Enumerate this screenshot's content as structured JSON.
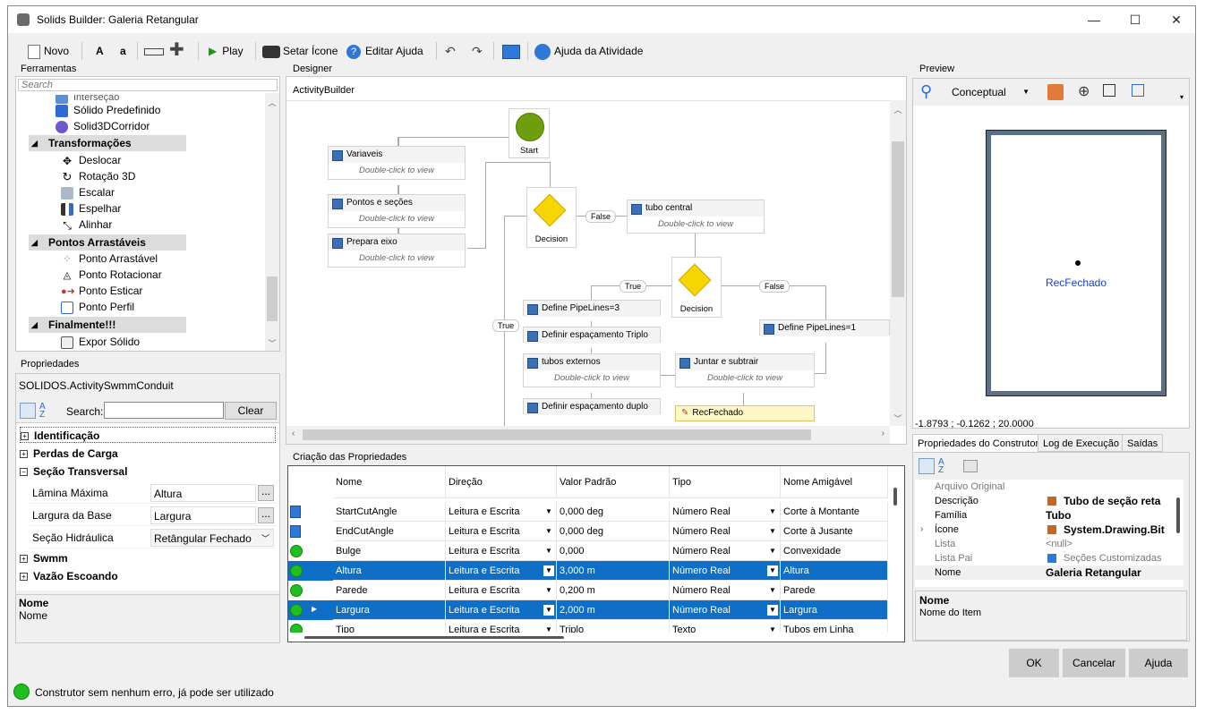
{
  "window": {
    "title": "Solids Builder: Galeria Retangular",
    "minimize": "—",
    "maximize": "☐",
    "close": "✕"
  },
  "toolbar": {
    "novo": "Novo",
    "bold_a": "A",
    "small_a": "a",
    "play": "Play",
    "setar_icone": "Setar Ícone",
    "editar_ajuda": "Editar Ajuda",
    "ajuda_atividade": "Ajuda da Atividade"
  },
  "ferramentas": {
    "title": "Ferramentas",
    "search_placeholder": "Search",
    "partial_item": "Interseção",
    "items_top": [
      "Sólido Predefinido",
      "Solid3DCorridor"
    ],
    "groups": [
      {
        "name": "Transformações",
        "items": [
          "Deslocar",
          "Rotação 3D",
          "Escalar",
          "Espelhar",
          "Alinhar"
        ]
      },
      {
        "name": "Pontos Arrastáveis",
        "items": [
          "Ponto Arrastável",
          "Ponto Rotacionar",
          "Ponto Esticar",
          "Ponto Perfil"
        ]
      },
      {
        "name": "Finalmente!!!",
        "items": [
          "Expor Sólido"
        ]
      }
    ]
  },
  "propriedades": {
    "title": "Propriedades",
    "object": "SOLIDOS.ActivitySwmmConduit",
    "search_label": "Search:",
    "clear": "Clear",
    "groups": {
      "identificacao": "Identificação",
      "perdas": "Perdas de Carga",
      "secao": "Seção Transversal",
      "swmm": "Swmm",
      "vazao": "Vazão Escoando"
    },
    "rows": [
      {
        "label": "Lâmina Máxima",
        "value": "Altura"
      },
      {
        "label": "Largura da Base",
        "value": "Largura"
      },
      {
        "label": "Seção Hidráulica",
        "value": "Retângular Fechado"
      }
    ],
    "desc_title": "Nome",
    "desc_text": "Nome"
  },
  "designer": {
    "title": "Designer",
    "breadcrumb": "ActivityBuilder",
    "start": "Start",
    "double_click": "Double-click to view",
    "nodes": {
      "variaveis": "Variaveis",
      "pontos": "Pontos e seções",
      "prepara": "Prepara eixo",
      "tubo_central": "tubo central",
      "define3": "Define PipeLines=3",
      "esp_triplo": "Definir espaçamento Triplo",
      "tubos_externos": "tubos externos",
      "juntar": "Juntar e subtrair",
      "esp_duplo": "Definir espaçamento duplo",
      "recfechado": "RecFechado",
      "define1": "Define PipeLines=1"
    },
    "decision": "Decision",
    "false_label": "False",
    "true_label": "True"
  },
  "criacao": {
    "title": "Criação das Propriedades",
    "headers": [
      "Nome",
      "Direção",
      "Valor Padrão",
      "Tipo",
      "Nome Amigável"
    ],
    "rows": [
      {
        "nome": "StartCutAngle",
        "direcao": "Leitura e Escrita",
        "valor": "0,000 deg",
        "tipo": "Número Real",
        "amigavel": "Corte à Montante"
      },
      {
        "nome": "EndCutAngle",
        "direcao": "Leitura e Escrita",
        "valor": "0,000 deg",
        "tipo": "Número Real",
        "amigavel": "Corte à Jusante"
      },
      {
        "nome": "Bulge",
        "direcao": "Leitura e Escrita",
        "valor": "0,000",
        "tipo": "Número Real",
        "amigavel": "Convexidade"
      },
      {
        "nome": "Altura",
        "direcao": "Leitura e Escrita",
        "valor": "3,000 m",
        "tipo": "Número Real",
        "amigavel": "Altura"
      },
      {
        "nome": "Parede",
        "direcao": "Leitura e Escrita",
        "valor": "0,200 m",
        "tipo": "Número Real",
        "amigavel": "Parede"
      },
      {
        "nome": "Largura",
        "direcao": "Leitura e Escrita",
        "valor": "2,000 m",
        "tipo": "Número Real",
        "amigavel": "Largura"
      },
      {
        "nome": "Tipo",
        "direcao": "Leitura e Escrita",
        "valor": "Triplo",
        "tipo": "Texto",
        "amigavel": "Tubos em Linha"
      }
    ]
  },
  "preview": {
    "title": "Preview",
    "view_mode": "Conceptual",
    "object_label": "RecFechado",
    "coords": "-1.8793 ; -0.1262 ; 20.0000"
  },
  "construtor": {
    "tabs": [
      "Propriedades do Construtor",
      "Log de Execução",
      "Saídas"
    ],
    "rows": [
      {
        "label": "Arquivo Original",
        "value": ""
      },
      {
        "label": "Descrição",
        "value": "Tubo de seção reta"
      },
      {
        "label": "Família",
        "value": "Tubo"
      },
      {
        "label": "Ícone",
        "value": "System.Drawing.Bit"
      },
      {
        "label": "Lista",
        "value": "<null>"
      },
      {
        "label": "Lista Pai",
        "value": "Seções Customizadas"
      },
      {
        "label": "Nome",
        "value": "Galeria Retangular"
      }
    ],
    "desc_title": "Nome",
    "desc_text": "Nome do Item"
  },
  "buttons": {
    "ok": "OK",
    "cancelar": "Cancelar",
    "ajuda": "Ajuda"
  },
  "status": "Construtor sem nenhum erro, já pode ser utilizado"
}
